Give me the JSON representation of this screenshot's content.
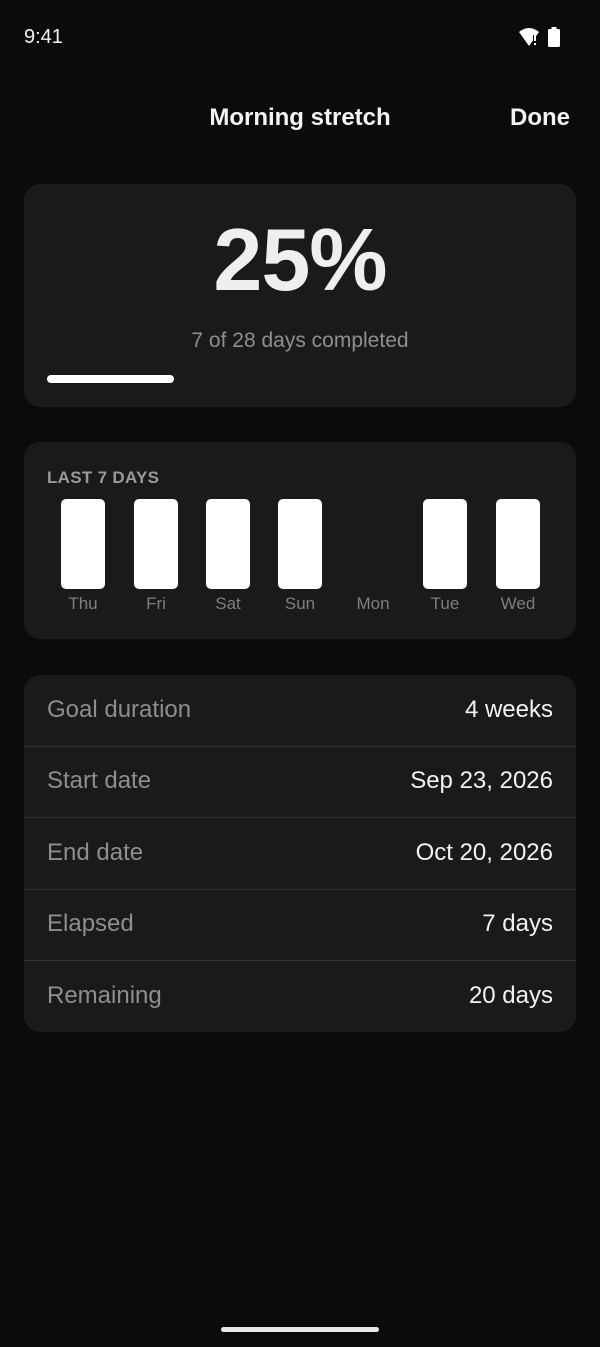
{
  "status_bar": {
    "time": "9:41"
  },
  "header": {
    "title": "Morning stretch",
    "done_label": "Done"
  },
  "progress": {
    "percent_text": "25%",
    "caption": "7 of 28 days completed",
    "fraction": 0.25
  },
  "last7": {
    "title": "LAST 7 DAYS",
    "days": [
      {
        "label": "Thu",
        "completed": true
      },
      {
        "label": "Fri",
        "completed": true
      },
      {
        "label": "Sat",
        "completed": true
      },
      {
        "label": "Sun",
        "completed": true
      },
      {
        "label": "Mon",
        "completed": false
      },
      {
        "label": "Tue",
        "completed": true
      },
      {
        "label": "Wed",
        "completed": true
      }
    ]
  },
  "details": [
    {
      "label": "Goal duration",
      "value": "4 weeks"
    },
    {
      "label": "Start date",
      "value": "Sep 23, 2026"
    },
    {
      "label": "End date",
      "value": "Oct 20, 2026"
    },
    {
      "label": "Elapsed",
      "value": "7 days"
    },
    {
      "label": "Remaining",
      "value": "20 days"
    }
  ],
  "icons": {
    "wifi": "wifi-icon",
    "battery": "battery-icon"
  },
  "colors": {
    "background": "#0b0b0b",
    "card": "#1a1a1a",
    "accent": "#ffffff"
  }
}
